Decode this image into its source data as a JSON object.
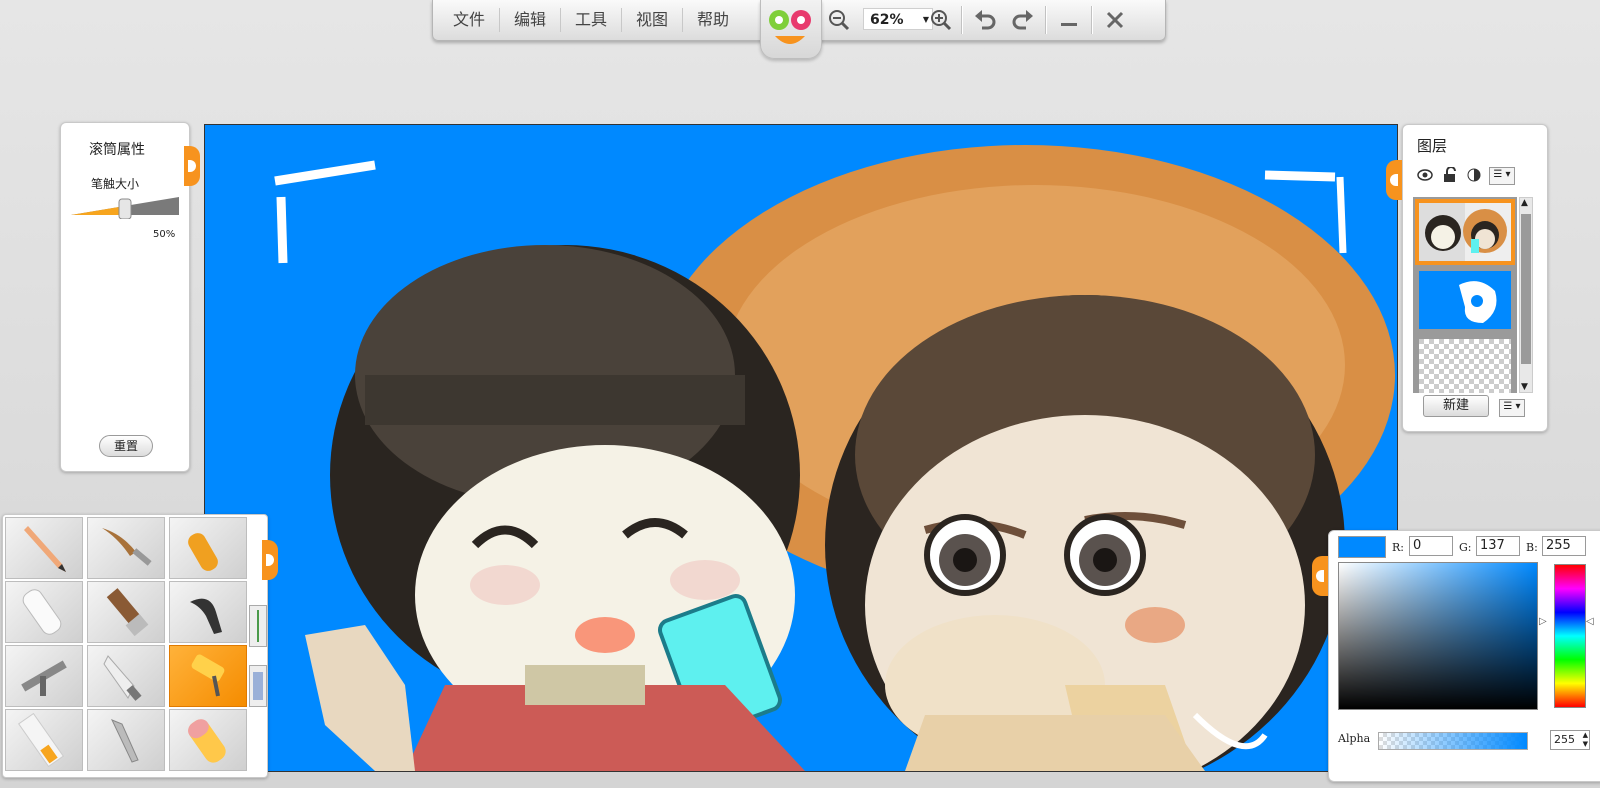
{
  "menu": {
    "items": [
      "文件",
      "编辑",
      "工具",
      "视图",
      "帮助"
    ]
  },
  "toolbar": {
    "zoom": "62%"
  },
  "brush_panel": {
    "title": "滚筒属性",
    "size_label": "笔触大小",
    "size_value": "50%",
    "reset_label": "重置"
  },
  "layers_panel": {
    "title": "图层",
    "new_label": "新建",
    "layer_count": 3,
    "selected_layer": 1
  },
  "tools": {
    "selected_index": 8
  },
  "color": {
    "r": "0",
    "g": "137",
    "b": "255",
    "r_label": "R:",
    "g_label": "G:",
    "b_label": "B:",
    "alpha_label": "Alpha",
    "alpha": "255",
    "current": "#0089ff"
  },
  "colors": {
    "accent": "#f7931e",
    "canvas_bg": "#0089ff"
  }
}
